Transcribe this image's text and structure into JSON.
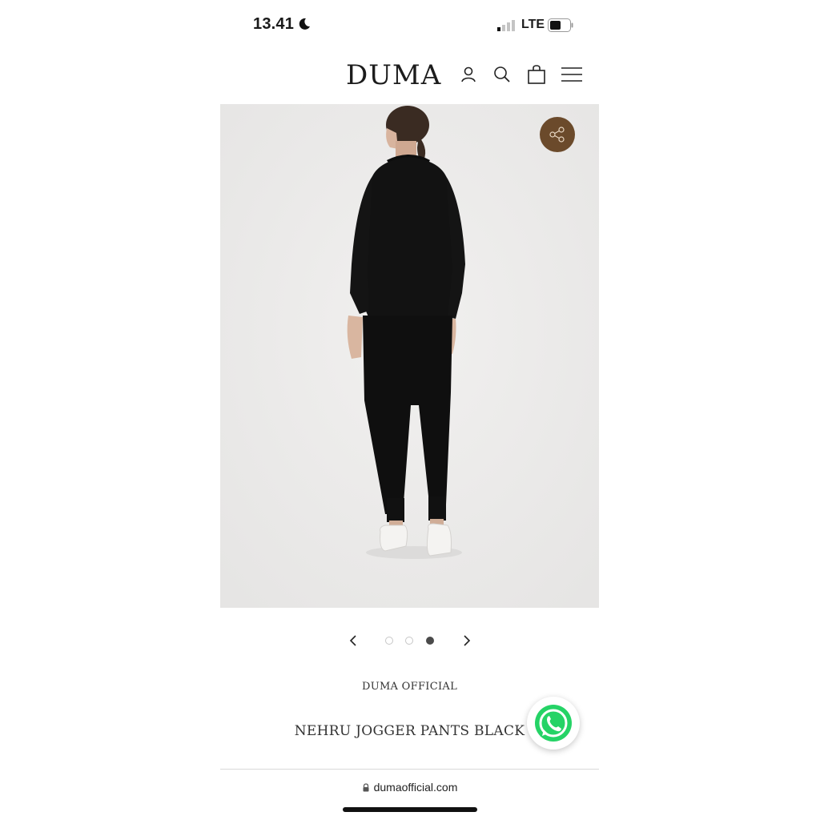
{
  "status_bar": {
    "time": "13.41",
    "network": "LTE"
  },
  "header": {
    "logo": "DUMA",
    "icons": [
      "account-icon",
      "search-icon",
      "cart-icon",
      "menu-icon"
    ]
  },
  "gallery": {
    "image_alt_subject": "model-back-view",
    "current_slide": 3,
    "slide_count": 3
  },
  "product": {
    "brand": "DUMA OFFICIAL",
    "name": "NEHRU JOGGER PANTS BLACK"
  },
  "browser": {
    "url": "dumaofficial.com"
  },
  "colors": {
    "share_button": "#6b4a2b",
    "whatsapp": "#25d366",
    "image_bg": "#ebeae9"
  }
}
